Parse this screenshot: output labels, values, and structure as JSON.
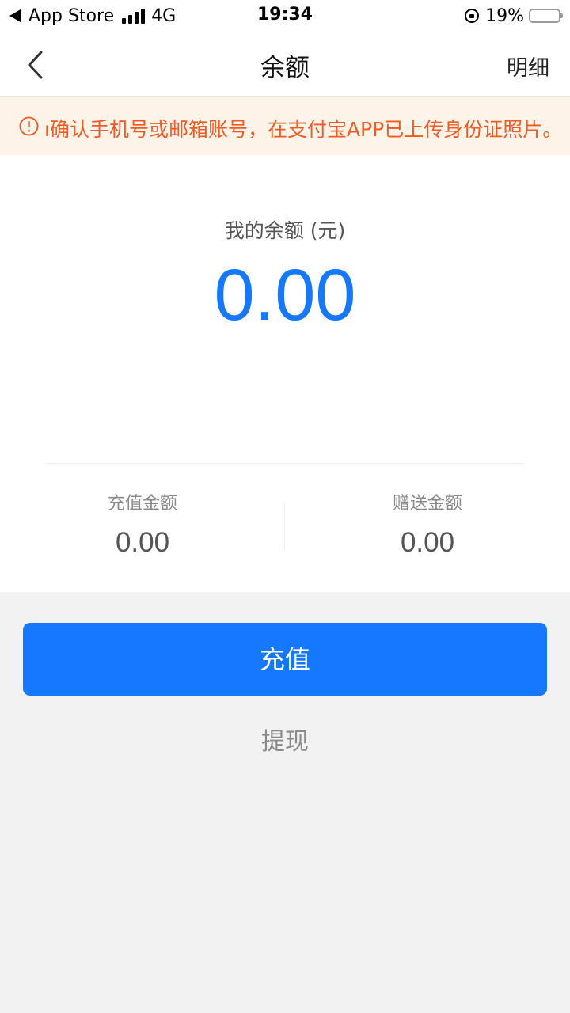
{
  "status_bar": {
    "back_app": "App Store",
    "network": "4G",
    "time": "19:34",
    "battery": "19%",
    "battery_level": 0.19
  },
  "nav": {
    "title": "余额",
    "detail_label": "明细",
    "icons": {
      "back": "chevron-left-icon"
    }
  },
  "notice": {
    "icon": "alert-circle-icon",
    "text": "ı确认手机号或邮箱账号，在支付宝APP已上传身份证照片。",
    "color": "#f05a24",
    "background": "#fef3e8"
  },
  "balance": {
    "label": "我的余额 (元)",
    "value": "0.00",
    "color": "#1677ff"
  },
  "breakdown": {
    "recharge_label": "充值金额",
    "recharge_value": "0.00",
    "bonus_label": "赠送金额",
    "bonus_value": "0.00"
  },
  "actions": {
    "recharge_label": "充值",
    "withdraw_label": "提现",
    "accent": "#1677ff"
  }
}
